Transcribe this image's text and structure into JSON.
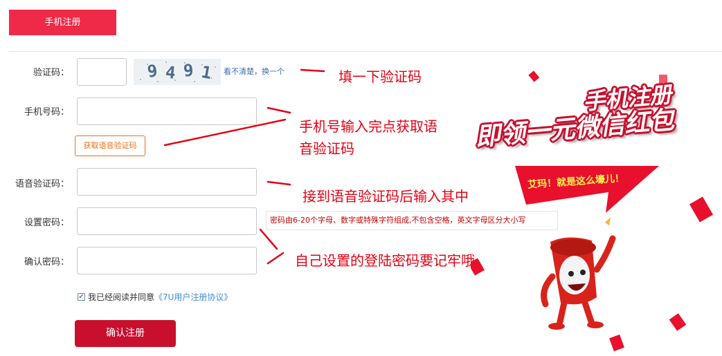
{
  "tab": {
    "label": "手机注册"
  },
  "form": {
    "captcha_label": "验证码：",
    "captcha_text": "9491",
    "captcha_refresh": "看不清楚，换一个",
    "phone_label": "手机号码：",
    "voice_button": "获取语音验证码",
    "voice_code_label": "语音验证码：",
    "password_label": "设置密码：",
    "password_tip": "密码由6-20个字母、数字或特殊字符组成,不包含空格，英文字母区分大小写",
    "confirm_label": "确认密码：",
    "agree_text": "我已经阅读并同意",
    "agree_link": "《7U用户注册协议》",
    "submit": "确认注册"
  },
  "annotations": {
    "captcha": "填一下验证码",
    "phone_line1": "手机号输入完点获取语",
    "phone_line2": "音验证码",
    "voice": "接到语音验证码后输入其中",
    "password": "自己设置的登陆密码要记牢哦"
  },
  "promo": {
    "title_line1": "手机注册",
    "title_line2": "即领一元微信红包",
    "bubble": "艾玛！就是这么壕儿！"
  },
  "colors": {
    "accent": "#ee2a48",
    "submit": "#c8102e",
    "annotation": "#e60012",
    "voice_button": "#e2731f",
    "link": "#3b8ed8"
  }
}
